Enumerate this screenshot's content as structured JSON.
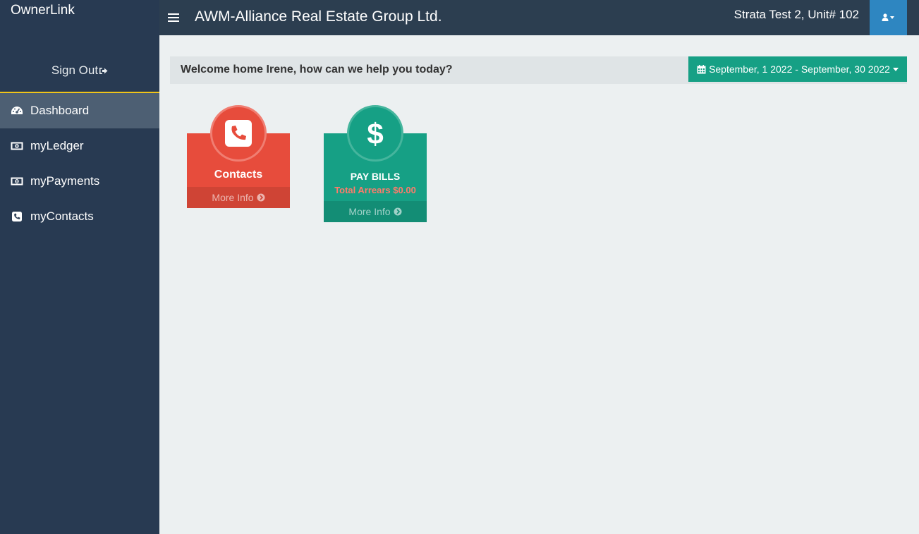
{
  "app": {
    "brand": "OwnerLink",
    "company": "AWM-Alliance Real Estate Group Ltd.",
    "unit": "Strata Test 2, Unit# 102"
  },
  "sidebar": {
    "signout_label": "Sign Out",
    "items": [
      {
        "label": "Dashboard",
        "icon": "dashboard-icon",
        "active": true
      },
      {
        "label": "myLedger",
        "icon": "money-icon"
      },
      {
        "label": "myPayments",
        "icon": "money-icon"
      },
      {
        "label": "myContacts",
        "icon": "phone-icon"
      }
    ]
  },
  "main": {
    "welcome": "Welcome home Irene, how can we help you today?",
    "date_range": "September, 1 2022 - September, 30 2022",
    "tiles": {
      "contacts": {
        "title": "Contacts",
        "footer": "More Info"
      },
      "paybills": {
        "title": "PAY BILLS",
        "arrears": "Total Arrears $0.00",
        "footer": "More Info"
      }
    }
  },
  "colors": {
    "topbar": "#2c3e50",
    "sidebar": "#283a52",
    "accent_green": "#16a085",
    "accent_red": "#e74c3c",
    "user_button": "#2e86c1",
    "signout_border": "#f0c419"
  }
}
